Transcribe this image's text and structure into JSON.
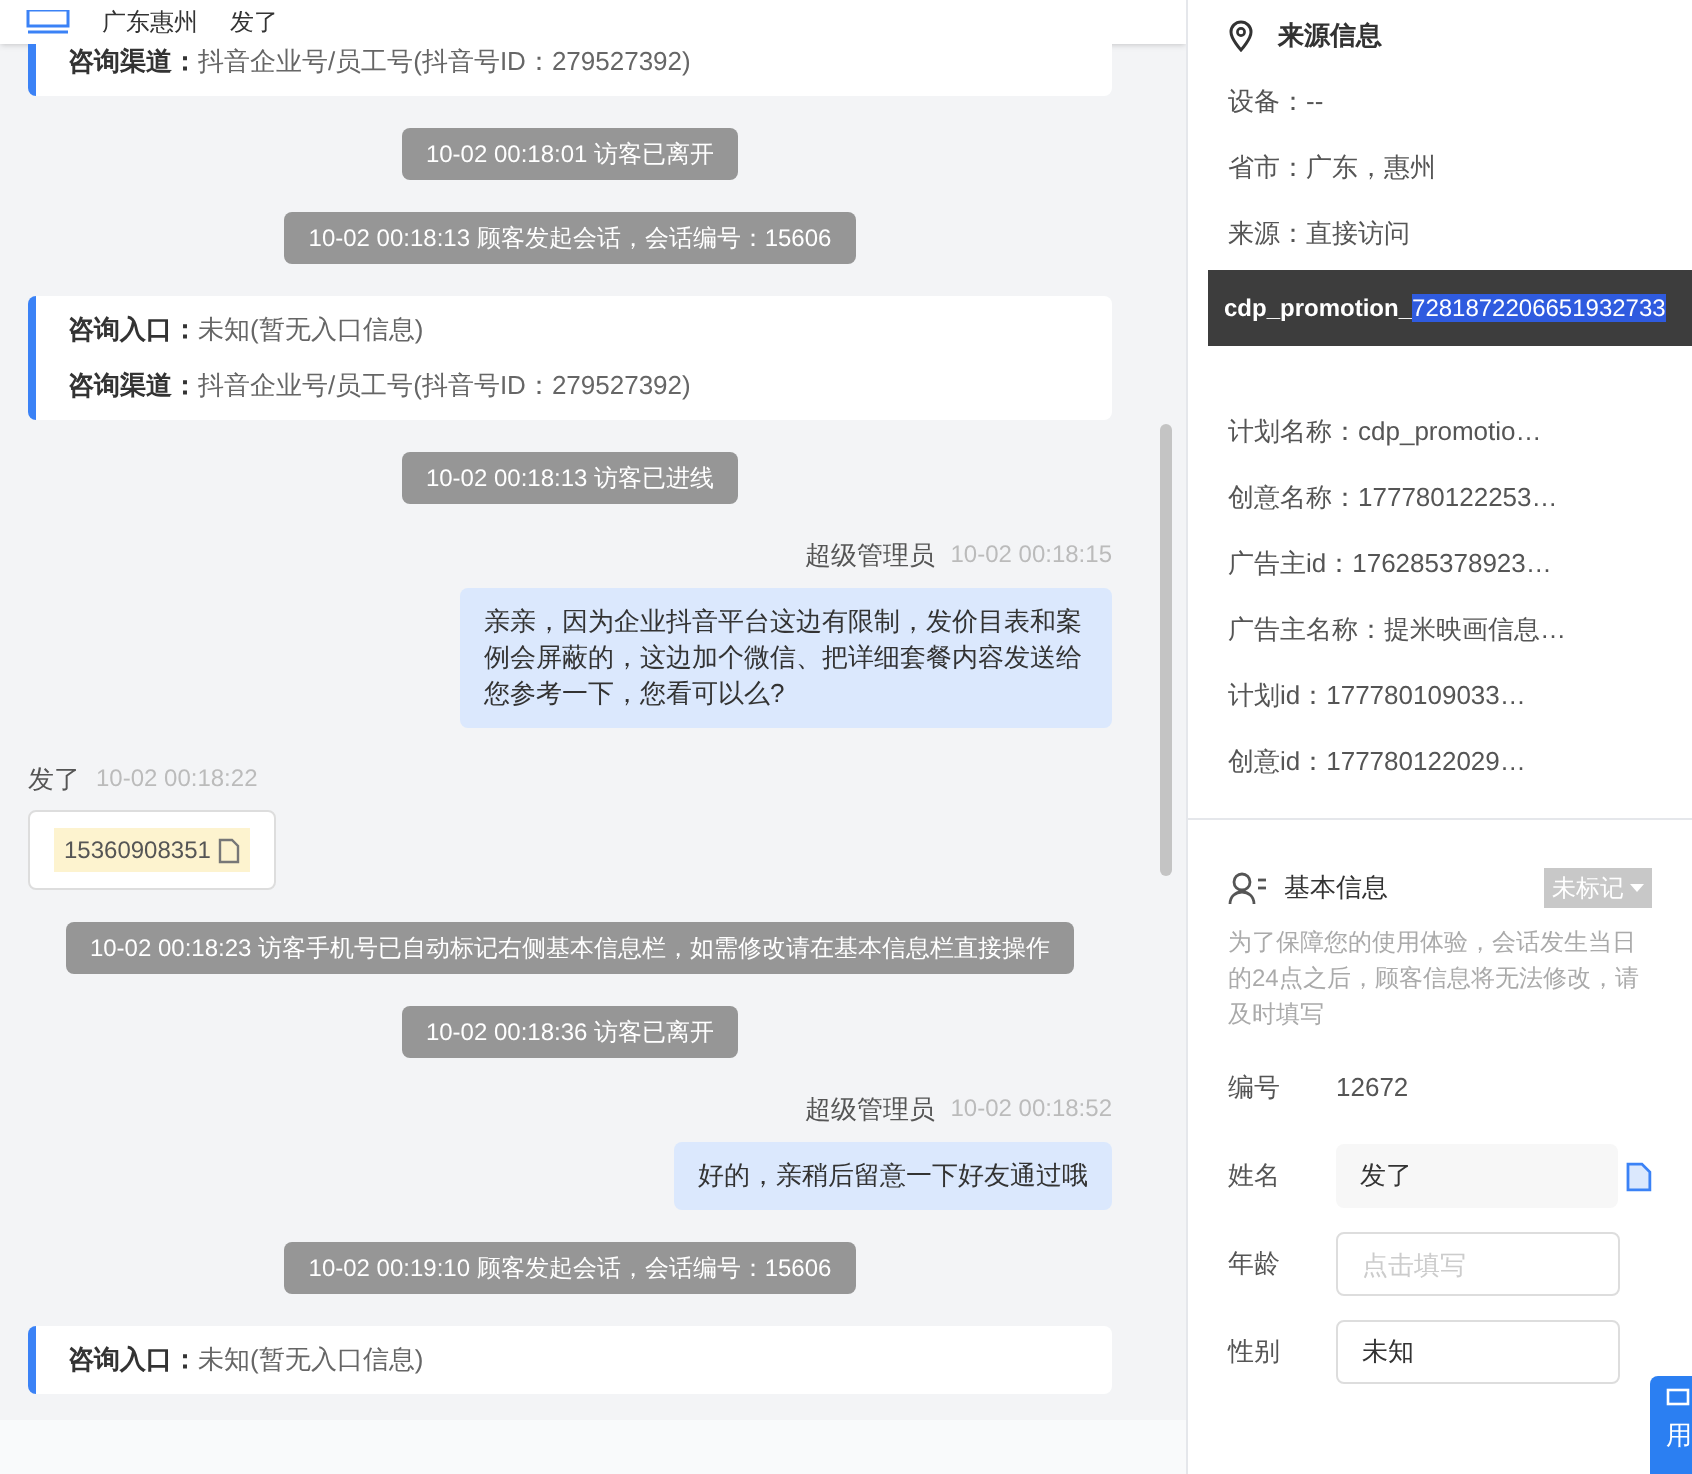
{
  "header": {
    "location": "广东惠州",
    "visitor": "发了"
  },
  "messages": [
    {
      "kind": "info",
      "lines": [
        {
          "label": "咨询渠道：",
          "value": "抖音企业号/员工号(抖音号ID：279527392)"
        }
      ]
    },
    {
      "kind": "system",
      "text": "10-02 00:18:01 访客已离开"
    },
    {
      "kind": "system",
      "text": "10-02 00:18:13 顾客发起会话，会话编号：15606"
    },
    {
      "kind": "info",
      "lines": [
        {
          "label": "咨询入口：",
          "value": "未知(暂无入口信息)"
        },
        {
          "label": "咨询渠道：",
          "value": "抖音企业号/员工号(抖音号ID：279527392)"
        }
      ]
    },
    {
      "kind": "system",
      "text": "10-02 00:18:13 访客已进线"
    },
    {
      "kind": "agent",
      "name": "超级管理员",
      "time": "10-02 00:18:15",
      "text": "亲亲，因为企业抖音平台这边有限制，发价目表和案例会屏蔽的，这边加个微信、把详细套餐内容发送给您参考一下，您看可以么?"
    },
    {
      "kind": "visitor",
      "name": "发了",
      "time": "10-02 00:18:22",
      "phone": "15360908351"
    },
    {
      "kind": "system",
      "text": "10-02 00:18:23 访客手机号已自动标记右侧基本信息栏，如需修改请在基本信息栏直接操作"
    },
    {
      "kind": "system",
      "text": "10-02 00:18:36 访客已离开"
    },
    {
      "kind": "agent",
      "name": "超级管理员",
      "time": "10-02 00:18:52",
      "text": "好的，亲稍后留意一下好友通过哦"
    },
    {
      "kind": "system",
      "text": "10-02 00:19:10 顾客发起会话，会话编号：15606"
    },
    {
      "kind": "info",
      "lines": [
        {
          "label": "咨询入口：",
          "value": "未知(暂无入口信息)"
        }
      ]
    }
  ],
  "source_info": {
    "title": "来源信息",
    "rows_before": [
      {
        "text": "设备：--"
      },
      {
        "text": "省市：广东，惠州"
      },
      {
        "text": "来源：直接访问"
      }
    ],
    "tooltip": {
      "text": "cdp_promotion_",
      "selected_text": "7281872206651932733"
    },
    "rows_after": [
      {
        "text": "计划名称：cdp_promotio…"
      },
      {
        "text": "创意名称：177780122253…"
      },
      {
        "text": "广告主id：176285378923…"
      },
      {
        "text": "广告主名称：提米映画信息…"
      },
      {
        "text": "计划id：177780109033…"
      },
      {
        "text": "创意id：177780122029…"
      }
    ]
  },
  "basic_info": {
    "title": "基本信息",
    "tag": "未标记",
    "notice": "为了保障您的使用体验，会话发生当日的24点之后，顾客信息将无法修改，请及时填写",
    "fields": [
      {
        "kind": "plain",
        "label": "编号",
        "value": "12672"
      },
      {
        "kind": "readonly",
        "label": "姓名",
        "value": "发了"
      },
      {
        "kind": "input",
        "label": "年龄",
        "placeholder": "点击填写"
      },
      {
        "kind": "input",
        "label": "性别",
        "value": "未知"
      }
    ]
  },
  "floating_button": {
    "label": "用"
  }
}
